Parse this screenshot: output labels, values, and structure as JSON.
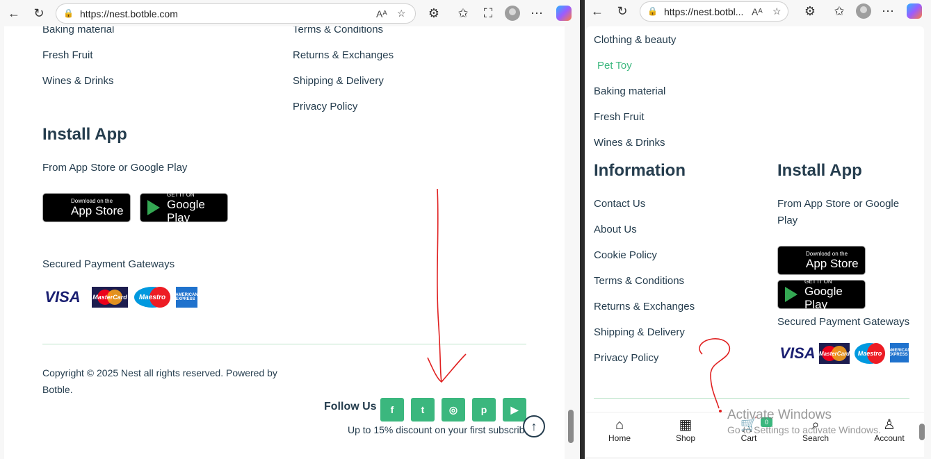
{
  "left_window": {
    "url": "https://nest.botble.com",
    "categories": [
      "Baking material",
      "Fresh Fruit",
      "Wines & Drinks"
    ],
    "information_links": [
      "Terms & Conditions",
      "Returns & Exchanges",
      "Shipping & Delivery",
      "Privacy Policy"
    ],
    "install_app_title": "Install App",
    "install_app_text": "From App Store or Google Play",
    "app_store": {
      "line1": "Download on the",
      "line2": "App Store"
    },
    "google_play": {
      "line1": "GET IT ON",
      "line2": "Google Play"
    },
    "payment_title": "Secured Payment Gateways",
    "payment_cards": {
      "visa": "VISA",
      "mastercard": "MasterCard",
      "maestro": "Maestro",
      "amex": "AMERICAN EXPRESS"
    },
    "copyright": "Copyright © 2025 Nest all rights reserved. Powered by Botble.",
    "follow_us": "Follow Us",
    "social": {
      "facebook": "f",
      "twitter": "t",
      "instagram": "◎",
      "pinterest": "p",
      "youtube": "▶"
    },
    "discount_text": "Up to 15% discount on your first subscribe"
  },
  "right_window": {
    "url": "https://nest.botbl...",
    "categories": [
      "Clothing & beauty",
      "Pet Toy",
      "Baking material",
      "Fresh Fruit",
      "Wines & Drinks"
    ],
    "information_title": "Information",
    "information_links": [
      "Contact Us",
      "About Us",
      "Cookie Policy",
      "Terms & Conditions",
      "Returns & Exchanges",
      "Shipping & Delivery",
      "Privacy Policy"
    ],
    "install_app_title": "Install App",
    "install_app_text_1": "From App Store or Google",
    "install_app_text_2": "Play",
    "app_store": {
      "line1": "Download on the",
      "line2": "App Store"
    },
    "google_play": {
      "line1": "GET IT ON",
      "line2": "Google Play"
    },
    "payment_title": "Secured Payment Gateways",
    "payment_cards": {
      "visa": "VISA",
      "mastercard": "MasterCard",
      "maestro": "Maestro",
      "amex": "AMERICAN EXPRESS"
    },
    "bottom_nav": {
      "home": "Home",
      "shop": "Shop",
      "cart": "Cart",
      "search": "Search",
      "account": "Account",
      "cart_count": "0"
    }
  },
  "watermark": {
    "line1": "Activate Windows",
    "line2": "Go to Settings to activate Windows."
  },
  "colors": {
    "accent": "#3bb77e",
    "heading": "#253d4e",
    "annotation": "#e02020"
  }
}
